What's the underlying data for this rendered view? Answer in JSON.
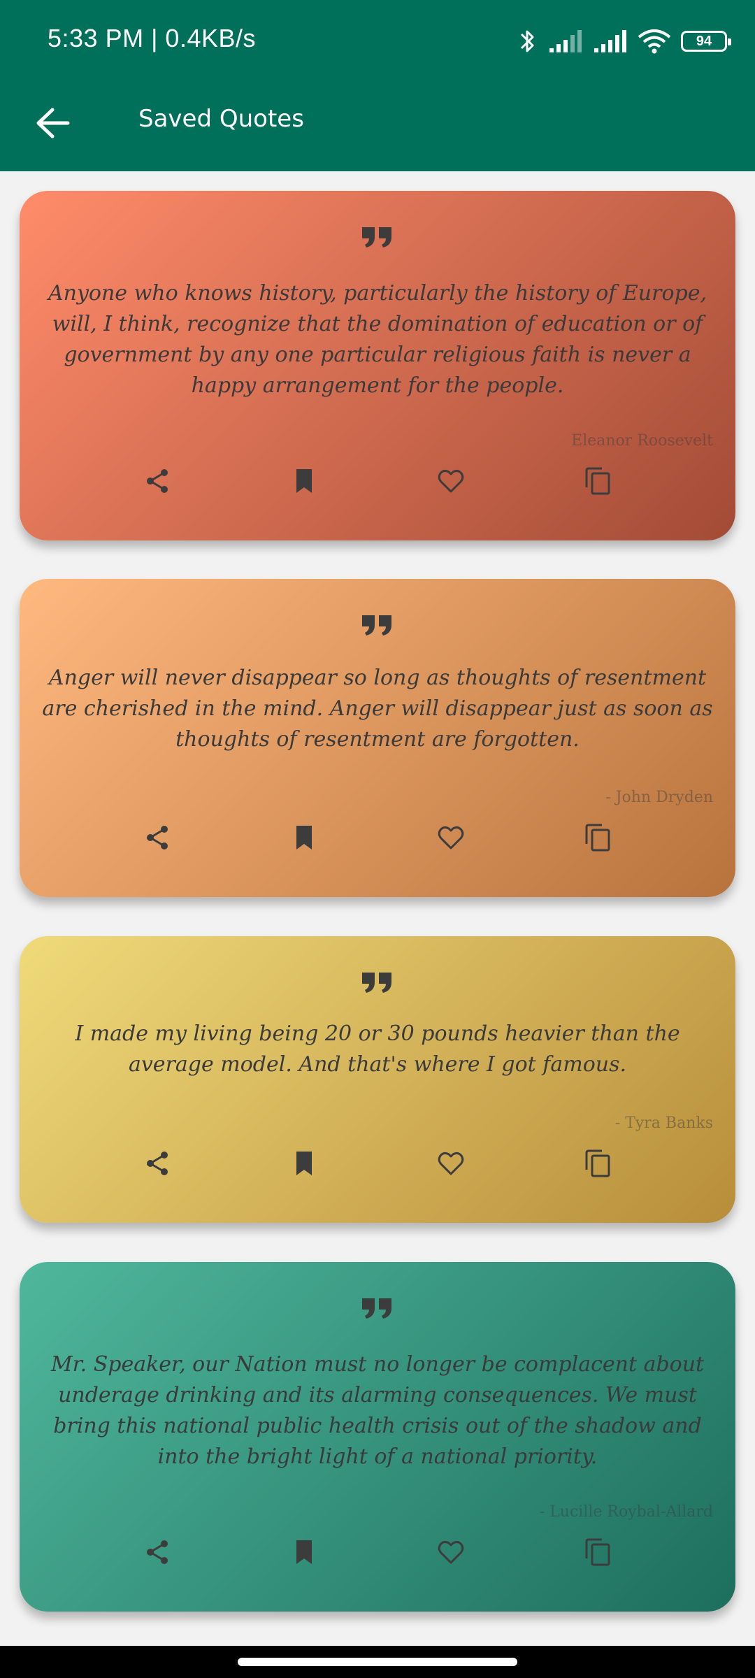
{
  "status": {
    "time_speed": "5:33 PM | 0.4KB/s",
    "battery": "94",
    "icons": [
      "bluetooth-icon",
      "signal-icon",
      "signal-icon",
      "wifi-icon",
      "battery-icon"
    ]
  },
  "appbar": {
    "title": "Saved Quotes",
    "back_icon": "arrow-back-icon",
    "background": "#00705b"
  },
  "quotes": [
    {
      "text": "Anyone who knows history, particularly the history of Europe, will, I think, recognize that the domination of education or of government by any one particular religious faith is never a happy arrangement for the people.",
      "author": "Eleanor Roosevelt",
      "gradient": [
        "#ff8c6a",
        "#a34b36"
      ]
    },
    {
      "text": "Anger will never disappear so long as thoughts of resentment are cherished in the mind. Anger will disappear just as soon as thoughts of resentment are forgotten.",
      "author": "- John Dryden",
      "gradient": [
        "#ffb97f",
        "#b8733d"
      ]
    },
    {
      "text": "I made my living being 20 or 30 pounds heavier than the average model. And that's where I got famous.",
      "author": "- Tyra Banks",
      "gradient": [
        "#f0da7a",
        "#b88d3a"
      ]
    },
    {
      "text": "Mr. Speaker, our Nation must no longer be complacent about underage drinking and its alarming consequences. We must bring this national public health crisis out of the shadow and into the bright light of a national priority.",
      "author": "- Lucille Roybal-Allard",
      "gradient": [
        "#4fb79c",
        "#1d6e5d"
      ]
    }
  ],
  "card_actions": [
    "share-icon",
    "bookmark-icon",
    "heart-outline-icon",
    "copy-icon"
  ]
}
